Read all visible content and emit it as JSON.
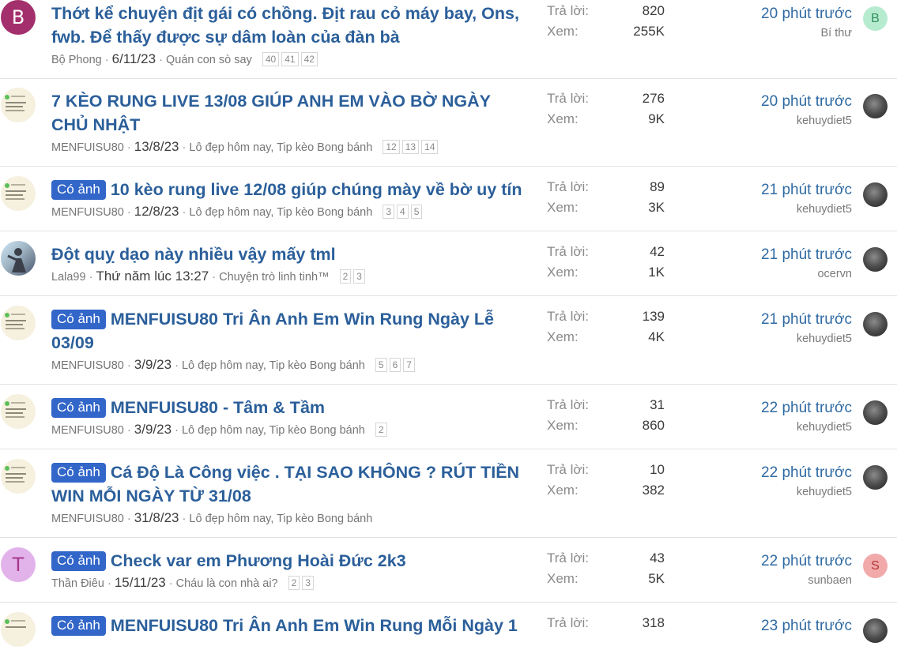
{
  "threads": [
    {
      "avatar": {
        "kind": "letter",
        "letter": "B",
        "color": "#a3306c"
      },
      "badge": "",
      "title": "Thớt kể chuyện địt gái có chồng. Địt rau cỏ máy bay, Ons, fwb. Để thấy được sự dâm loàn của đàn bà",
      "author": "Bộ Phong",
      "date": "6/11/23",
      "forum": "Quán con sò say",
      "pages": [
        "40",
        "41",
        "42"
      ],
      "replies_label": "Trả lời:",
      "replies": "820",
      "views_label": "Xem:",
      "views": "255K",
      "last_time": "20 phút trước",
      "last_user": "Bí thư",
      "last_avatar": {
        "kind": "letter",
        "letter": "B",
        "color": "#b7ebcf"
      }
    },
    {
      "avatar": {
        "kind": "image",
        "icon": "menfuisu80-avatar"
      },
      "badge": "",
      "title": "7 KÈO RUNG LIVE 13/08 GIÚP ANH EM VÀO BỜ NGÀY CHỦ NHẬT",
      "author": "MENFUISU80",
      "date": "13/8/23",
      "forum": "Lô đẹp hôm nay, Tip kèo Bong bánh",
      "pages": [
        "12",
        "13",
        "14"
      ],
      "replies_label": "Trả lời:",
      "replies": "276",
      "views_label": "Xem:",
      "views": "9K",
      "last_time": "20 phút trước",
      "last_user": "kehuydiet5",
      "last_avatar": {
        "kind": "image",
        "icon": "user-photo-icon"
      }
    },
    {
      "avatar": {
        "kind": "image",
        "icon": "menfuisu80-avatar"
      },
      "badge": "Có ảnh",
      "title": "10 kèo rung live 12/08 giúp chúng mày về bờ uy tín",
      "author": "MENFUISU80",
      "date": "12/8/23",
      "forum": "Lô đẹp hôm nay, Tip kèo Bong bánh",
      "pages": [
        "3",
        "4",
        "5"
      ],
      "replies_label": "Trả lời:",
      "replies": "89",
      "views_label": "Xem:",
      "views": "3K",
      "last_time": "21 phút trước",
      "last_user": "kehuydiet5",
      "last_avatar": {
        "kind": "image",
        "icon": "user-photo-icon"
      }
    },
    {
      "avatar": {
        "kind": "image",
        "icon": "lala99-avatar"
      },
      "badge": "",
      "title": "Đột quỵ dạo này nhiều vậy mấy tml",
      "author": "Lala99",
      "date": "Thứ năm lúc 13:27",
      "forum": "Chuyện trò linh tinh™",
      "pages": [
        "2",
        "3"
      ],
      "replies_label": "Trả lời:",
      "replies": "42",
      "views_label": "Xem:",
      "views": "1K",
      "last_time": "21 phút trước",
      "last_user": "ocervn",
      "last_avatar": {
        "kind": "image",
        "icon": "user-photo-icon"
      }
    },
    {
      "avatar": {
        "kind": "image",
        "icon": "menfuisu80-avatar"
      },
      "badge": "Có ảnh",
      "title": "MENFUISU80 Tri Ân Anh Em Win Rung Ngày Lễ 03/09",
      "author": "MENFUISU80",
      "date": "3/9/23",
      "forum": "Lô đẹp hôm nay, Tip kèo Bong bánh",
      "pages": [
        "5",
        "6",
        "7"
      ],
      "replies_label": "Trả lời:",
      "replies": "139",
      "views_label": "Xem:",
      "views": "4K",
      "last_time": "21 phút trước",
      "last_user": "kehuydiet5",
      "last_avatar": {
        "kind": "image",
        "icon": "user-photo-icon"
      }
    },
    {
      "avatar": {
        "kind": "image",
        "icon": "menfuisu80-avatar"
      },
      "badge": "Có ảnh",
      "title": "MENFUISU80 - Tâm & Tầm",
      "author": "MENFUISU80",
      "date": "3/9/23",
      "forum": "Lô đẹp hôm nay, Tip kèo Bong bánh",
      "pages": [
        "2"
      ],
      "replies_label": "Trả lời:",
      "replies": "31",
      "views_label": "Xem:",
      "views": "860",
      "last_time": "22 phút trước",
      "last_user": "kehuydiet5",
      "last_avatar": {
        "kind": "image",
        "icon": "user-photo-icon"
      }
    },
    {
      "avatar": {
        "kind": "image",
        "icon": "menfuisu80-avatar"
      },
      "badge": "Có ảnh",
      "title": "Cá Độ Là Công việc . TẠI SAO KHÔNG ? RÚT TIỀN WIN MỖI NGÀY TỪ 31/08",
      "author": "MENFUISU80",
      "date": "31/8/23",
      "forum": "Lô đẹp hôm nay, Tip kèo Bong bánh",
      "pages": [],
      "replies_label": "Trả lời:",
      "replies": "10",
      "views_label": "Xem:",
      "views": "382",
      "last_time": "22 phút trước",
      "last_user": "kehuydiet5",
      "last_avatar": {
        "kind": "image",
        "icon": "user-photo-icon"
      }
    },
    {
      "avatar": {
        "kind": "letter",
        "letter": "T",
        "color": "#e2b3eb"
      },
      "badge": "Có ảnh",
      "title": "Check var em Phương Hoài Đức 2k3",
      "author": "Thần Điêu",
      "date": "15/11/23",
      "forum": "Cháu là con nhà ai?",
      "pages": [
        "2",
        "3"
      ],
      "replies_label": "Trả lời:",
      "replies": "43",
      "views_label": "Xem:",
      "views": "5K",
      "last_time": "22 phút trước",
      "last_user": "sunbaen",
      "last_avatar": {
        "kind": "letter",
        "letter": "S",
        "color": "#f1a9a9"
      }
    },
    {
      "avatar": {
        "kind": "image",
        "icon": "menfuisu80-avatar"
      },
      "badge": "Có ảnh",
      "title": "MENFUISU80 Tri Ân Anh Em Win Rung Mỗi Ngày 1",
      "replies_label": "Trả lời:",
      "replies": "318",
      "last_time": "23 phút trước",
      "last_avatar": {
        "kind": "image",
        "icon": "user-photo-icon"
      }
    }
  ]
}
